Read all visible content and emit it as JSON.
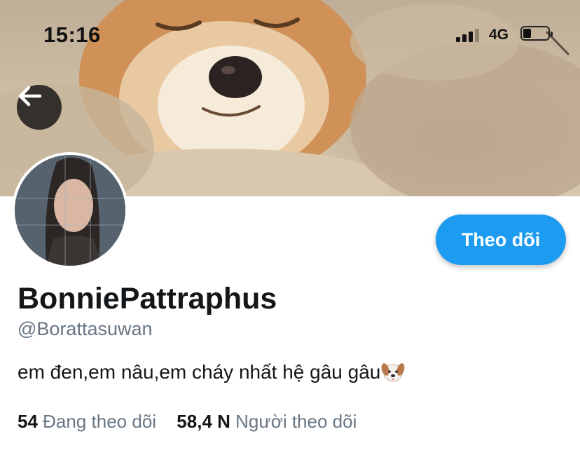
{
  "status_bar": {
    "time": "15:16",
    "network": "4G",
    "icons": [
      "signal-icon",
      "battery-icon"
    ]
  },
  "header": {
    "back_icon": "arrow-left-icon",
    "banner_image": "dog-on-sand-photo"
  },
  "profile": {
    "follow_label": "Theo dõi",
    "display_name": "BonniePattraphus",
    "handle": "@Borattasuwan",
    "bio": "em đen,em nâu,em cháy nhất hệ gâu gâu",
    "bio_emoji": "dog-face-icon",
    "following_count": "54",
    "following_label": "Đang theo dõi",
    "followers_count": "58,4 N",
    "followers_label": "Người theo dõi"
  },
  "colors": {
    "accent": "#1d9bf0",
    "text_primary": "#14171a",
    "text_secondary": "#687684"
  }
}
